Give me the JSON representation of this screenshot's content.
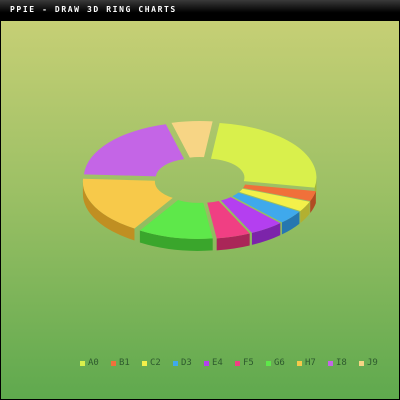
{
  "title": "PPIE - DRAW 3D RING CHARTS",
  "chart_data": {
    "type": "pie",
    "variant": "3d-ring-exploded",
    "title": "PPIE - DRAW 3D RING CHARTS",
    "legend_position": "bottom",
    "slices": [
      {
        "label": "A0",
        "value": 26,
        "color": "#d9f04c",
        "shade": "#a3b834"
      },
      {
        "label": "B1",
        "value": 3,
        "color": "#f0703a",
        "shade": "#b04c22"
      },
      {
        "label": "C2",
        "value": 3,
        "color": "#f3f04a",
        "shade": "#b2b030"
      },
      {
        "label": "D3",
        "value": 4,
        "color": "#3fa9ec",
        "shade": "#2677b0"
      },
      {
        "label": "E4",
        "value": 5,
        "color": "#b43ff0",
        "shade": "#7c24aa"
      },
      {
        "label": "F5",
        "value": 5,
        "color": "#f03f83",
        "shade": "#aa2658"
      },
      {
        "label": "G6",
        "value": 11,
        "color": "#5ee84a",
        "shade": "#3aa62c"
      },
      {
        "label": "H7",
        "value": 17,
        "color": "#f7c94a",
        "shade": "#c08f22"
      },
      {
        "label": "I8",
        "value": 20,
        "color": "#c465e6",
        "shade": "#8a40aa"
      },
      {
        "label": "J9",
        "value": 6,
        "color": "#f7d585",
        "shade": "#c0a05a"
      }
    ]
  }
}
